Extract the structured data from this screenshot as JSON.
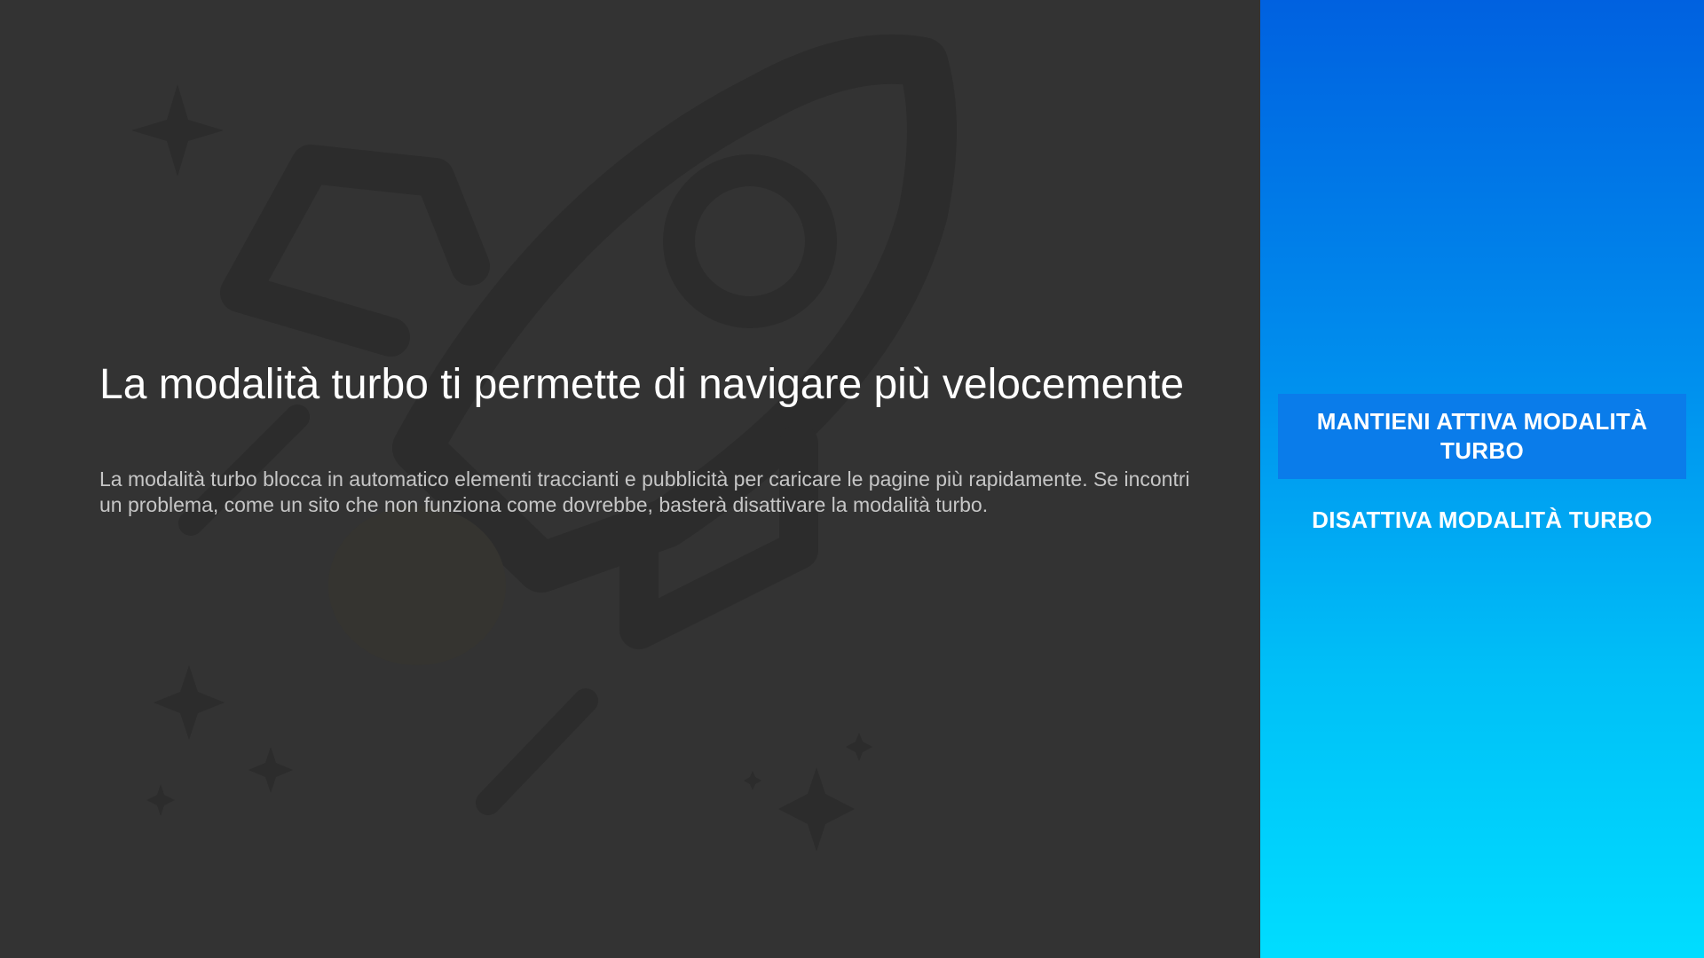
{
  "dialog": {
    "title": "La modalità turbo ti permette di navigare più velocemente",
    "description": "La modalità turbo blocca in automatico elementi traccianti e pubblicità per caricare le pagine più rapidamente. Se incontri un problema, come un sito che non funziona come dovrebbe, basterà disattivare la modalità turbo.",
    "background_icon": "rocket-illustration-icon"
  },
  "actions": {
    "keep_label": "MANTIENI ATTIVA MODALITÀ TURBO",
    "disable_label": "DISATTIVA MODALITÀ TURBO"
  },
  "colors": {
    "main_background": "#333333",
    "side_gradient_top": "#0061e0",
    "side_gradient_bottom": "#00ddff",
    "focused_button": "#0a7cea"
  }
}
